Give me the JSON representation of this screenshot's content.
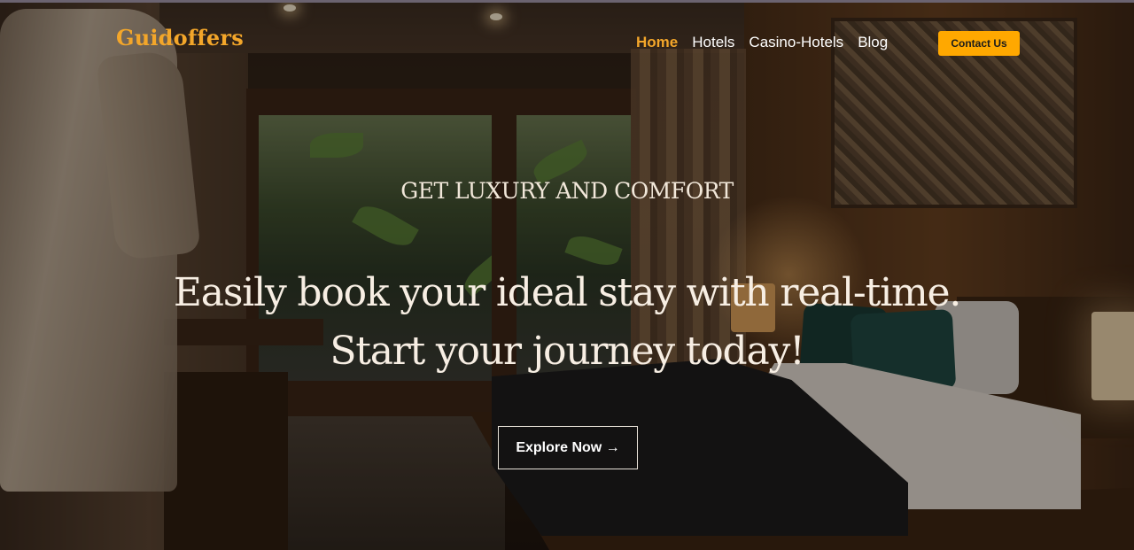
{
  "header": {
    "logo": "Guidoffers",
    "nav": [
      {
        "label": "Home",
        "active": true
      },
      {
        "label": "Hotels",
        "active": false
      },
      {
        "label": "Casino-Hotels",
        "active": false
      },
      {
        "label": "Blog",
        "active": false
      }
    ],
    "contact_label": "Contact Us"
  },
  "hero": {
    "eyebrow": "GET LUXURY AND COMFORT",
    "headline_line1": "Easily book your ideal stay with real-time.",
    "headline_line2": "Start your journey today!",
    "cta_label": "Explore Now →",
    "background_image": "hotel-room-photo"
  },
  "colors": {
    "accent": "#ffa800",
    "logo": "#f3a62a",
    "nav_active": "#f3a62a",
    "text_light": "#ffffff"
  }
}
